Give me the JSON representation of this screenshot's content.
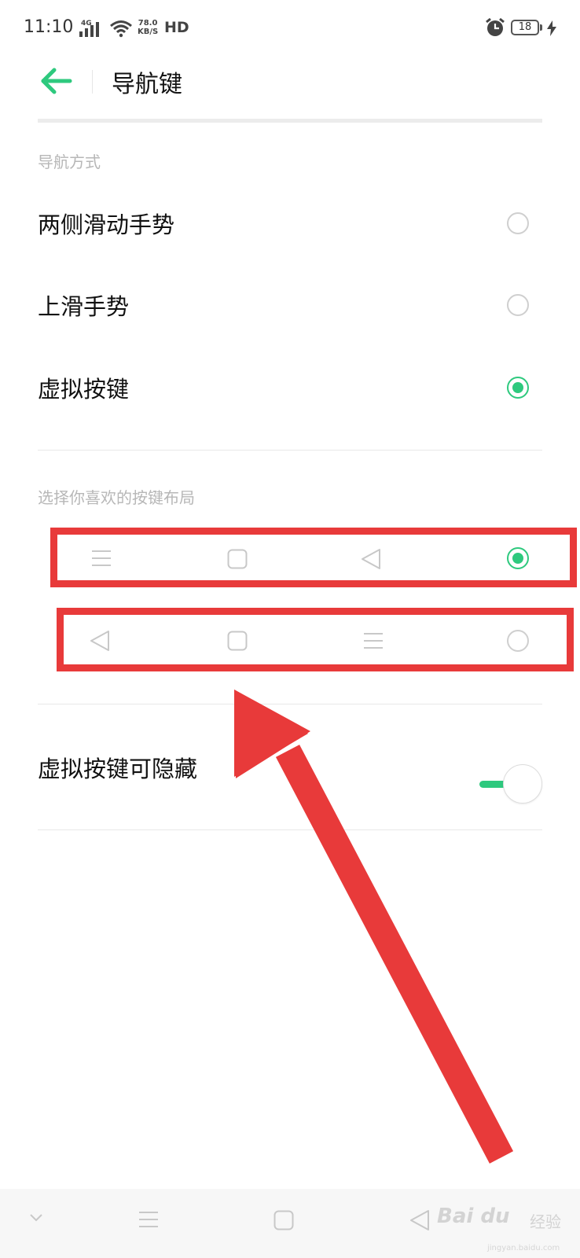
{
  "status_bar": {
    "time": "11:10",
    "network": "4G",
    "speed_value": "78.0",
    "speed_unit": "KB/S",
    "hd": "HD",
    "battery": "18"
  },
  "header": {
    "title": "导航键"
  },
  "nav_method": {
    "section_label": "导航方式",
    "options": [
      {
        "label": "两侧滑动手势",
        "selected": false
      },
      {
        "label": "上滑手势",
        "selected": false
      },
      {
        "label": "虚拟按键",
        "selected": true
      }
    ]
  },
  "layout": {
    "section_label": "选择你喜欢的按键布局",
    "options": [
      {
        "icons": [
          "menu-icon",
          "home-square-icon",
          "back-triangle-icon"
        ],
        "selected": true
      },
      {
        "icons": [
          "back-triangle-icon",
          "home-square-icon",
          "menu-icon"
        ],
        "selected": false
      }
    ]
  },
  "hide_keys": {
    "label": "虚拟按键可隐藏",
    "enabled": true
  },
  "watermark": {
    "brand": "Bai du",
    "suffix": "经验",
    "url": "jingyan.baidu.com"
  },
  "colors": {
    "accent": "#2ec97e",
    "annotation": "#e83a3a"
  }
}
